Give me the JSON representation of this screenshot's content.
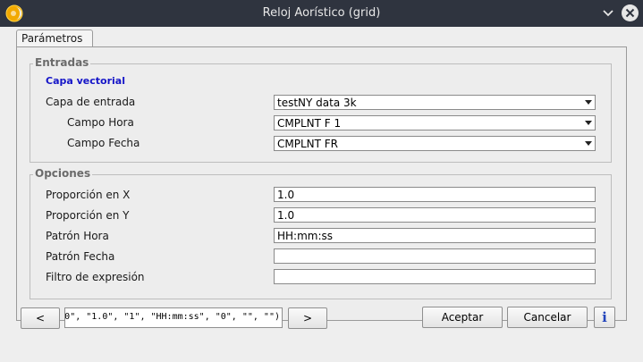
{
  "window": {
    "title": "Reloj Aorístico (grid)",
    "titlebar_color": "#2f343f"
  },
  "tabs": [
    {
      "label": "Parámetros"
    }
  ],
  "entradas": {
    "title": "Entradas",
    "section_label": "Capa vectorial",
    "section_color": "#1515c8",
    "fields": [
      {
        "label": "Capa de entrada",
        "value": "testNY data 3k"
      },
      {
        "label": "Campo Hora",
        "value": "CMPLNT F 1"
      },
      {
        "label": "Campo Fecha",
        "value": "CMPLNT FR"
      }
    ]
  },
  "opciones": {
    "title": "Opciones",
    "fields": [
      {
        "label": "Proporción en X",
        "value": "1.0"
      },
      {
        "label": "Proporción en Y",
        "value": "1.0"
      },
      {
        "label": "Patrón Hora",
        "value": "HH:mm:ss"
      },
      {
        "label": "Patrón Fecha",
        "value": ""
      },
      {
        "label": "Filtro de expresión",
        "value": ""
      }
    ]
  },
  "footer": {
    "prev_label": "<",
    "next_label": ">",
    "command_text": "0\", \"1.0\", \"1\", \"HH:mm:ss\", \"0\", \"\", \"\")",
    "accept_label": "Aceptar",
    "cancel_label": "Cancelar",
    "info_label": "i"
  },
  "icons": {
    "app": "app-logo-icon",
    "minimize": "chevron-down-icon",
    "close": "close-icon",
    "dropdown": "dropdown-arrow-icon",
    "info": "info-icon"
  }
}
